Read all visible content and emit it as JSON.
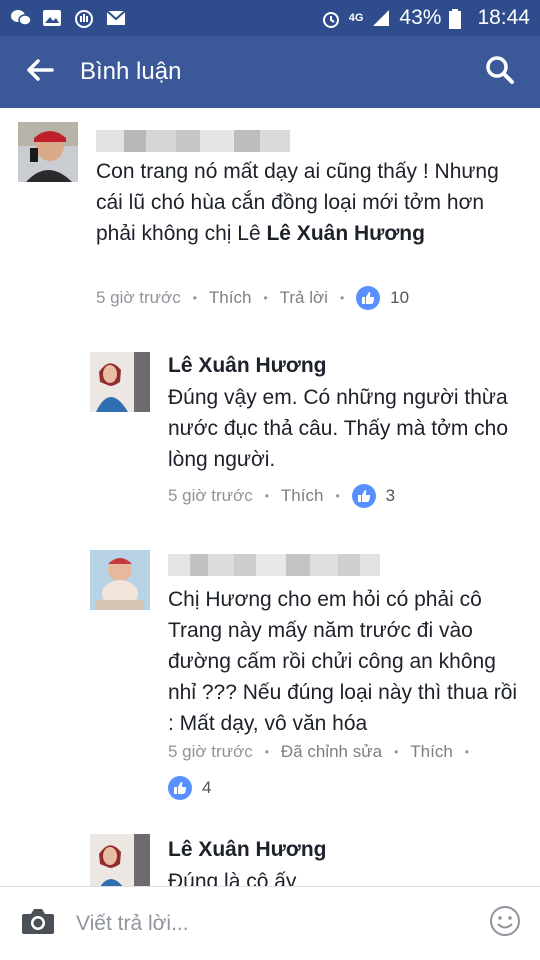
{
  "status_bar": {
    "network": "4G",
    "battery": "43%",
    "time": "18:44"
  },
  "header": {
    "title": "Bình luận",
    "back_icon": "back-arrow-icon",
    "search_icon": "search-icon"
  },
  "colors": {
    "status_bar_bg": "#2f4d8c",
    "app_bar_bg": "#3b5998",
    "like_blue": "#5890ff",
    "meta_gray": "#90949c"
  },
  "comments": [
    {
      "author": "",
      "text": "Con trang nó mất dạy ai cũng thấy ! Nhưng cái lũ chó hùa cắn đồng loại mới tởm hơn phải không chị Lê ",
      "mention": "Lê Xuân Hương",
      "time": "5 giờ trước",
      "like_label": "Thích",
      "reply_label": "Trả lời",
      "likes": "10"
    },
    {
      "author": "Lê Xuân Hương",
      "text": "Đúng vậy em. Có những người thừa nước đục thả câu. Thấy mà tởm cho lòng người.",
      "time": "5 giờ trước",
      "like_label": "Thích",
      "likes": "3"
    },
    {
      "author": "",
      "text": "Chị Hương cho em hỏi có phải cô Trang này mấy năm trước đi vào đường cấm rồi chửi công an không nhỉ ??? Nếu đúng loại này thì thua rồi : Mất dạy, vô văn hóa",
      "time": "5 giờ trước",
      "edited_label": "Đã chỉnh sửa",
      "like_label": "Thích",
      "likes": "4"
    },
    {
      "author": "Lê Xuân Hương",
      "text": "Đúng là cô ấy"
    }
  ],
  "reply_bar": {
    "placeholder": "Viết trả lời...",
    "camera_icon": "camera-icon",
    "emoji_icon": "smiley-icon"
  }
}
